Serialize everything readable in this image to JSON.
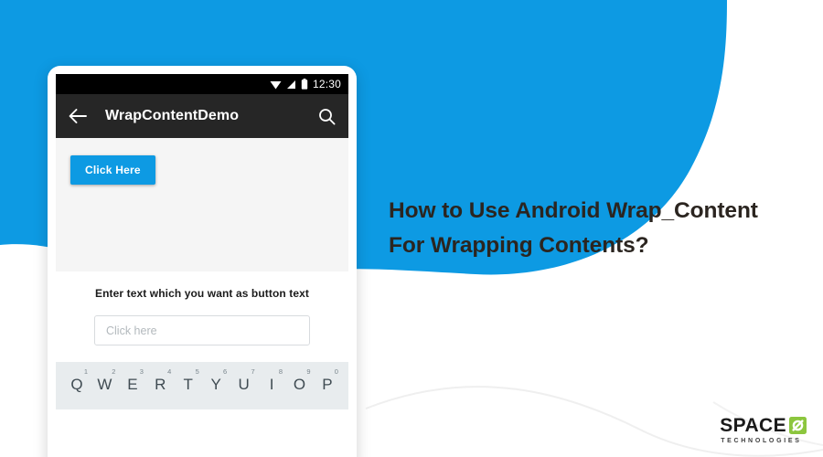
{
  "page": {
    "title": "How to Use Android Wrap_Content For Wrapping Contents?",
    "accent_blue": "#0d9ae3",
    "headline_color": "#2b2520",
    "logo_green": "#8cc63e"
  },
  "headline": {
    "line1": "How to Use Android Wrap_Content",
    "line2": "For Wrapping Contents?"
  },
  "phone": {
    "status_bar": {
      "time": "12:30",
      "icons": [
        "wifi-icon",
        "signal-icon",
        "battery-icon"
      ]
    },
    "toolbar": {
      "back_icon": "back-arrow-icon",
      "title": "WrapContentDemo",
      "search_icon": "search-icon"
    },
    "content": {
      "button_label": "Click Here"
    },
    "form": {
      "label": "Enter text which you want as button text",
      "input_value": "",
      "input_placeholder": "Click here"
    },
    "keyboard": {
      "row": [
        {
          "letter": "Q",
          "num": "1"
        },
        {
          "letter": "W",
          "num": "2"
        },
        {
          "letter": "E",
          "num": "3"
        },
        {
          "letter": "R",
          "num": "4"
        },
        {
          "letter": "T",
          "num": "5"
        },
        {
          "letter": "Y",
          "num": "6"
        },
        {
          "letter": "U",
          "num": "7"
        },
        {
          "letter": "I",
          "num": "8"
        },
        {
          "letter": "O",
          "num": "9"
        },
        {
          "letter": "P",
          "num": "0"
        }
      ]
    }
  },
  "logo": {
    "word": "SPACE",
    "mark": "slashed-o-icon",
    "subtitle": "TECHNOLOGIES"
  }
}
